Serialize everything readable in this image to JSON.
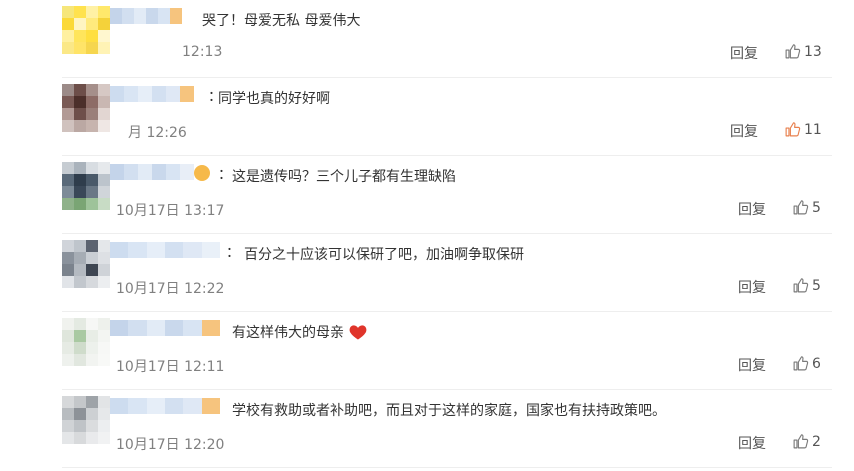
{
  "comments": [
    {
      "id": "c1",
      "text": "哭了！母爱无私 母爱伟大",
      "time": "12:13",
      "reply_label": "回复",
      "likes": "13",
      "liked": false,
      "avatar_colors": [
        "#f6e67a",
        "#ffe24e",
        "#fff1a5",
        "#ffe86b",
        "#fbd938",
        "#fff5c2",
        "#ffea7d",
        "#f4d23a",
        "#fff0a0",
        "#ffe55c",
        "#ffdf40",
        "#fff7cf",
        "#fbe887",
        "#ffe468",
        "#f6d64e",
        "#fff3b5"
      ],
      "name_colors": [
        "#c4d4ea",
        "#d2dff0",
        "#e2ebf6",
        "#c9d8ec",
        "#d8e4f3",
        "#f6c47e"
      ]
    },
    {
      "id": "c2",
      "text": "同学也真的好好啊",
      "time": "月 12:26",
      "reply_label": "回复",
      "likes": "11",
      "liked": true,
      "avatar_colors": [
        "#9c8b88",
        "#6d4e49",
        "#a58f8a",
        "#d6c8c4",
        "#7a5a55",
        "#4c2f2a",
        "#8d6c66",
        "#c9b7b2",
        "#b29a95",
        "#6e4f4a",
        "#9a7f79",
        "#e2d6d2",
        "#d0c2be",
        "#bba8a3",
        "#c7b4ae",
        "#efe7e4"
      ],
      "name_colors": [
        "#cddcef",
        "#d9e5f4",
        "#e6eef8",
        "#d3e0f1",
        "#dfe8f5",
        "#f6c47e"
      ]
    },
    {
      "id": "c3",
      "text": "这是遗传吗？三个儿子都有生理缺陷",
      "time": "10月17日 13:17",
      "reply_label": "回复",
      "likes": "5",
      "liked": false,
      "emoji": "#f6b94a",
      "avatar_colors": [
        "#c6ccd2",
        "#aab3bc",
        "#d8dde2",
        "#e6e9ec",
        "#5a6a7a",
        "#2f3d4c",
        "#4a5a6a",
        "#bcc4cc",
        "#7d8b98",
        "#3a4858",
        "#6a7886",
        "#d0d5da",
        "#8fb28a",
        "#7aa574",
        "#9ec39a",
        "#c8dcc5"
      ],
      "name_colors": [
        "#c4d4ea",
        "#d2dff0",
        "#e2ebf6",
        "#c9d8ec",
        "#d8e4f3",
        "#e8eef7"
      ]
    },
    {
      "id": "c4",
      "text": "百分之十应该可以保研了吧，加油啊争取保研",
      "time": "10月17日 12:22",
      "reply_label": "回复",
      "likes": "5",
      "liked": false,
      "avatar_colors": [
        "#d0d4da",
        "#bfc5cc",
        "#5b6370",
        "#e4e7ea",
        "#8a929c",
        "#a6adb5",
        "#c9ced4",
        "#dde0e4",
        "#7b838d",
        "#b4bac1",
        "#3e4652",
        "#cfd3d8",
        "#e1e4e8",
        "#c2c7cd",
        "#d6d9dd",
        "#eceef0"
      ],
      "name_colors": [
        "#cddcef",
        "#d9e5f4",
        "#e6eef8",
        "#d3e0f1",
        "#dfe8f5",
        "#e9f0f8"
      ]
    },
    {
      "id": "c5",
      "text": "有这样伟大的母亲",
      "time": "10月17日 12:11",
      "reply_label": "回复",
      "likes": "6",
      "liked": false,
      "heart": "#e0352b",
      "avatar_colors": [
        "#f0f2ee",
        "#e4eae2",
        "#f6f7f5",
        "#eef1ec",
        "#dfe6dc",
        "#a9c9a2",
        "#e8ede6",
        "#f3f5f2",
        "#e6ebe4",
        "#cfdccb",
        "#edf1ec",
        "#f7f8f6",
        "#eef1ed",
        "#e1e7df",
        "#f2f4f1",
        "#f8f9f7"
      ],
      "name_colors": [
        "#c4d4ea",
        "#d2dff0",
        "#e2ebf6",
        "#c9d8ec",
        "#d8e4f3",
        "#f6c47e"
      ]
    },
    {
      "id": "c6",
      "text": "学校有救助或者补助吧，而且对于这样的家庭，国家也有扶持政策吧。",
      "time": "10月17日 12:20",
      "reply_label": "回复",
      "likes": "2",
      "liked": false,
      "avatar_colors": [
        "#d6d8da",
        "#c4c7ca",
        "#9ea3a8",
        "#e2e4e6",
        "#b8bcc0",
        "#8d9298",
        "#cdd0d3",
        "#e6e8ea",
        "#d0d3d6",
        "#bfc3c7",
        "#dadcde",
        "#eceef0",
        "#e4e6e8",
        "#d8dadc",
        "#e9eaec",
        "#f1f2f3"
      ],
      "name_colors": [
        "#cddcef",
        "#d9e5f4",
        "#e6eef8",
        "#d3e0f1",
        "#dfe8f5",
        "#f6c47e"
      ]
    }
  ],
  "colors": {
    "like_active": "#e8804e",
    "like_default": "#7a7a7a",
    "time": "#808080",
    "divider": "#eeeeee"
  }
}
